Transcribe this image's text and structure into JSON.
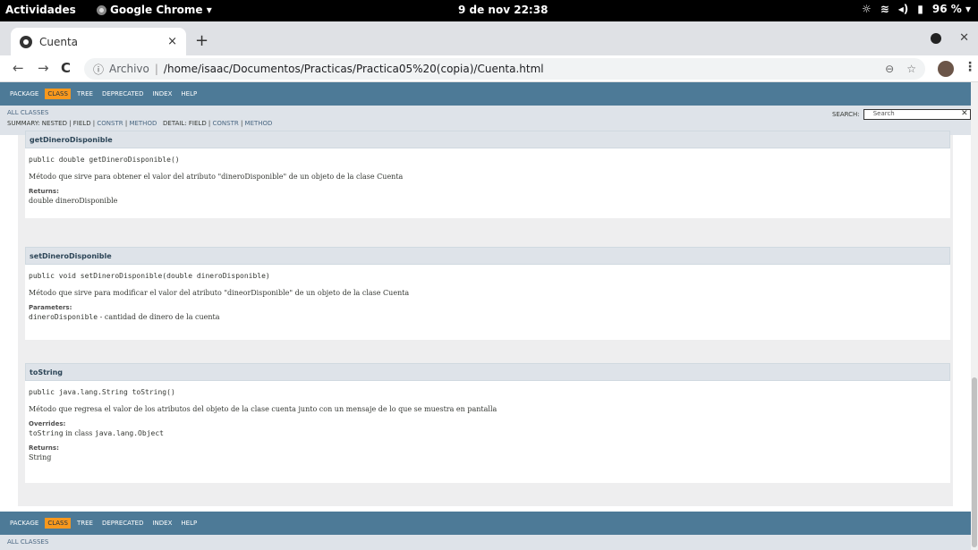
{
  "system_bar": {
    "activities": "Actividades",
    "app_name": "Google Chrome ▾",
    "clock": "9 de nov  22:38",
    "battery": "96 % ▾"
  },
  "browser": {
    "tab_title": "Cuenta",
    "tab_close": "×",
    "new_tab": "+",
    "url_label": "Archivo",
    "url": "/home/isaac/Documentos/Practicas/Practica05%20(copia)/Cuenta.html"
  },
  "javadoc": {
    "nav": [
      "PACKAGE",
      "CLASS",
      "TREE",
      "DEPRECATED",
      "INDEX",
      "HELP"
    ],
    "all_classes": "ALL CLASSES",
    "summary_prefix": "SUMMARY: NESTED | FIELD | ",
    "summary_constr": "CONSTR",
    "summary_mid": " | ",
    "summary_method": "METHOD",
    "detail_prefix": "   DETAIL: FIELD | ",
    "detail_constr": "CONSTR",
    "detail_mid": " | ",
    "detail_method": "METHOD",
    "search_label": "SEARCH:",
    "search_placeholder": "Search"
  },
  "methods": [
    {
      "name": "getDineroDisponible",
      "signature": "public double getDineroDisponible()",
      "description": "Método que sirve para obtener el valor del atributo \"dineroDisponible\" de un objeto de la clase Cuenta",
      "tag1": "Returns:",
      "val1": "double dineroDisponible"
    },
    {
      "name": "setDineroDisponible",
      "signature": "public void setDineroDisponible(double dineroDisponible)",
      "description": "Método que sirve para modificar el valor del atributo \"dineorDisponible\" de un objeto de la clase Cuenta",
      "tag1": "Parameters:",
      "val1_code": "dineroDisponible",
      "val1_text": " - cantidad de dinero de la cuenta"
    },
    {
      "name": "toString",
      "signature": "public java.lang.String toString()",
      "description": "Método que regresa el valor de los atributos del objeto de la clase cuenta junto con un mensaje de lo que se muestra en pantalla",
      "tag1": "Overrides:",
      "val1_code": "toString",
      "val1_text": " in class ",
      "val1_code2": "java.lang.Object",
      "tag2": "Returns:",
      "val2": "String"
    }
  ]
}
